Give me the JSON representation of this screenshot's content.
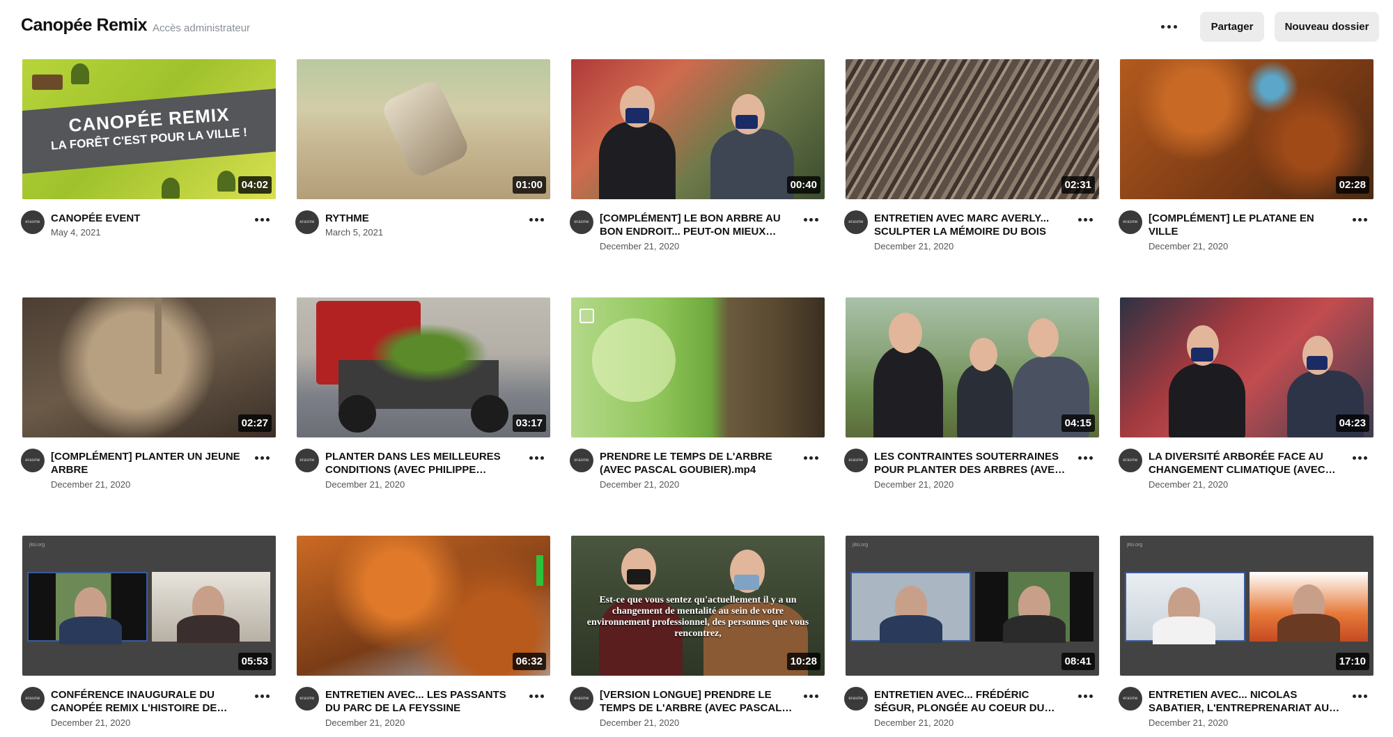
{
  "header": {
    "title": "Canopée Remix",
    "subtitle": "Accès administrateur",
    "more_icon": "more-horizontal-icon",
    "share_label": "Partager",
    "new_folder_label": "Nouveau dossier"
  },
  "avatar_text": "erasme",
  "event_thumb": {
    "line1": "CANOPÉE REMIX",
    "line2": "LA FORÊT C'EST POUR LA VILLE !"
  },
  "version_caption": "Est-ce que vous sentez qu'actuellement il y a un changement de mentalité au sein de votre environnement professionnel, des personnes que vous rencontrez,",
  "jitsi_label": "jitsi.org",
  "videos": [
    {
      "title": "CANOPÉE EVENT",
      "date": "May 4, 2021",
      "duration": "04:02"
    },
    {
      "title": "RYTHME",
      "date": "March 5, 2021",
      "duration": "01:00"
    },
    {
      "title": "[COMPLÉMENT] LE BON ARBRE AU BON ENDROIT... PEUT-ON MIEUX…",
      "date": "December 21, 2020",
      "duration": "00:40"
    },
    {
      "title": "ENTRETIEN AVEC MARC AVERLY... SCULPTER LA MÉMOIRE DU BOIS",
      "date": "December 21, 2020",
      "duration": "02:31"
    },
    {
      "title": "[COMPLÉMENT] LE PLATANE EN VILLE",
      "date": "December 21, 2020",
      "duration": "02:28"
    },
    {
      "title": "[COMPLÉMENT] PLANTER UN JEUNE ARBRE",
      "date": "December 21, 2020",
      "duration": "02:27"
    },
    {
      "title": "PLANTER DANS LES MEILLEURES CONDITIONS (AVEC PHILIPPE…",
      "date": "December 21, 2020",
      "duration": "03:17"
    },
    {
      "title": "PRENDRE LE TEMPS DE L'ARBRE (AVEC PASCAL GOUBIER).mp4",
      "date": "December 21, 2020",
      "duration": ""
    },
    {
      "title": "LES CONTRAINTES SOUTERRAINES POUR PLANTER DES ARBRES (AVE…",
      "date": "December 21, 2020",
      "duration": "04:15"
    },
    {
      "title": "LA DIVERSITÉ ARBORÉE FACE AU CHANGEMENT CLIMATIQUE (AVEC…",
      "date": "December 21, 2020",
      "duration": "04:23"
    },
    {
      "title": "CONFÉRENCE INAUGURALE DU CANOPÉE REMIX L'HISTOIRE DE…",
      "date": "December 21, 2020",
      "duration": "05:53"
    },
    {
      "title": "ENTRETIEN AVEC... LES PASSANTS DU PARC DE LA FEYSSINE",
      "date": "December 21, 2020",
      "duration": "06:32"
    },
    {
      "title": "[VERSION LONGUE] PRENDRE LE TEMPS DE L'ARBRE (AVEC PASCAL…",
      "date": "December 21, 2020",
      "duration": "10:28"
    },
    {
      "title": "ENTRETIEN AVEC... FRÉDÉRIC SÉGUR, PLONGÉE AU COEUR DU…",
      "date": "December 21, 2020",
      "duration": "08:41"
    },
    {
      "title": "ENTRETIEN AVEC... NICOLAS SABATIER, L'ENTREPRENARIAT AU…",
      "date": "December 21, 2020",
      "duration": "17:10"
    }
  ]
}
